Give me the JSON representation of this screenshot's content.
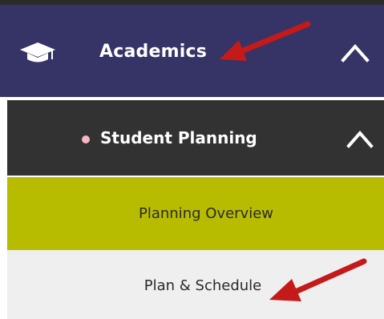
{
  "menu": {
    "academics": {
      "label": "Academics",
      "icon": "graduation-cap-icon",
      "expanded": true,
      "color": "#363366"
    },
    "student_planning": {
      "label": "Student Planning",
      "expanded": true,
      "color": "#323232",
      "bullet_color": "#f3b8c4"
    },
    "planning_overview": {
      "label": "Planning Overview",
      "color": "#b8bc00"
    },
    "plan_schedule": {
      "label": "Plan & Schedule",
      "color": "#efefef"
    }
  },
  "annotations": {
    "arrow_color": "#c41a1a"
  }
}
